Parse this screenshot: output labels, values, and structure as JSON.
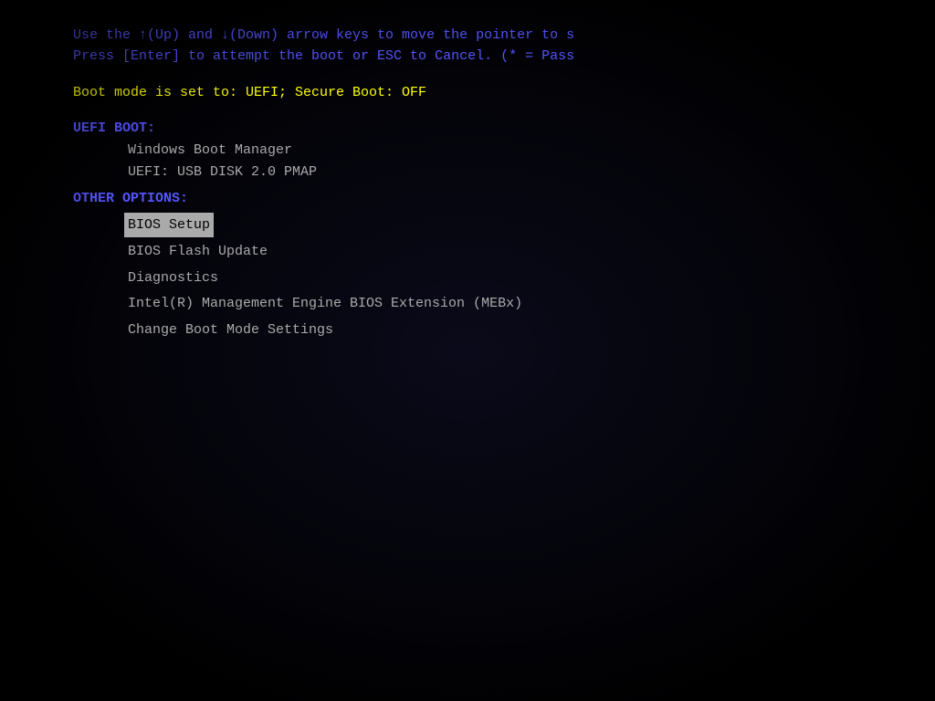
{
  "screen": {
    "instructions": {
      "line1": "Use the ↑(Up) and ↓(Down) arrow keys to move the pointer to s",
      "line2": "Press [Enter] to attempt the boot or ESC to Cancel. (* = Pass"
    },
    "boot_mode": "Boot mode is set to: UEFI; Secure Boot: OFF",
    "uefi_boot": {
      "label": "UEFI BOOT:",
      "items": [
        "Windows Boot Manager",
        "UEFI:  USB DISK 2.0 PMAP"
      ]
    },
    "other_options": {
      "label": "OTHER OPTIONS:",
      "items": [
        {
          "label": "BIOS Setup",
          "selected": true
        },
        {
          "label": "BIOS Flash Update",
          "selected": false
        },
        {
          "label": "Diagnostics",
          "selected": false
        },
        {
          "label": "Intel(R) Management Engine BIOS Extension (MEBx)",
          "selected": false
        },
        {
          "label": "Change Boot Mode Settings",
          "selected": false
        }
      ]
    }
  }
}
